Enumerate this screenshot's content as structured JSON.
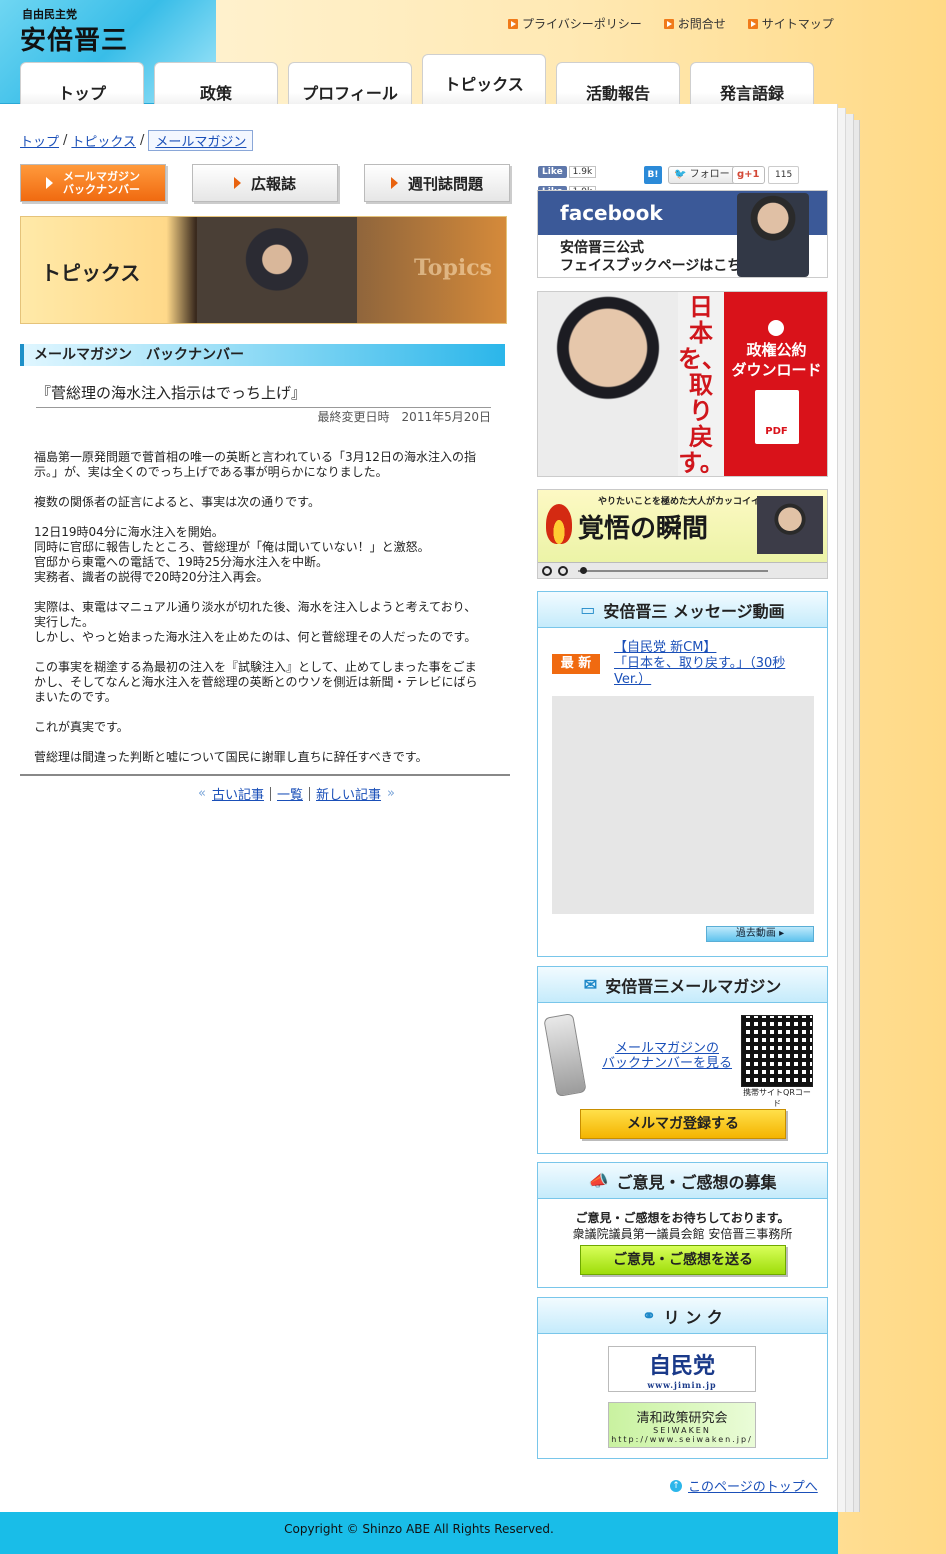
{
  "header": {
    "party": "自由民主党",
    "name": "安倍晋三",
    "util_links": [
      "プライバシーポリシー",
      "お問合せ",
      "サイトマップ"
    ]
  },
  "nav": {
    "tabs": [
      "トップ",
      "政策",
      "プロフィール",
      "トピックス",
      "活動報告",
      "発言語録"
    ],
    "active": "トピックス"
  },
  "breadcrumb": {
    "items": [
      "トップ",
      "トピックス",
      "メールマガジン"
    ]
  },
  "subnav": {
    "buttons": [
      "メールマガジン\nバックナンバー",
      "広報誌",
      "週刊誌問題"
    ]
  },
  "hero": {
    "label": "トピックス",
    "en_label": "Topics"
  },
  "section": {
    "title": "メールマガジン　バックナンバー"
  },
  "article": {
    "title": "『菅総理の海水注入指示はでっち上げ』",
    "date": "最終変更日時　2011年5月20日",
    "paragraphs": [
      "福島第一原発問題で菅首相の唯一の英断と言われている「3月12日の海水注入の指示。」が、実は全くのでっち上げである事が明らかになりました。",
      "複数の関係者の証言によると、事実は次の通りです。",
      "12日19時04分に海水注入を開始。\n同時に官邸に報告したところ、菅総理が「俺は聞いていない！」と激怒。\n官邸から東電への電話で、19時25分海水注入を中断。\n実務者、識者の説得で20時20分注入再会。",
      "実際は、東電はマニュアル通り淡水が切れた後、海水を注入しようと考えており、実行した。\nしかし、やっと始まった海水注入を止めたのは、何と菅総理その人だったのです。",
      "この事実を糊塗する為最初の注入を『試験注入』として、止めてしまった事をごまかし、そしてなんと海水注入を菅総理の英断とのウソを側近は新聞・テレビにばらまいたのです。",
      "これが真実です。",
      "菅総理は間違った判断と嘘について国民に謝罪し直ちに辞任すべきです。"
    ]
  },
  "pager": {
    "prev": "古い記事",
    "list": "一覧",
    "next": "新しい記事"
  },
  "social": {
    "like": "Like",
    "like_count_1": "1.9k",
    "like_count_2": "1.9k",
    "hatena": "B!",
    "twitter": "フォロー",
    "gplus": "+1",
    "gplus_count": "115"
  },
  "fb_banner": {
    "logo": "facebook",
    "text": "安倍晋三公式\nフェイスブックページはこちら"
  },
  "manifesto_banner": {
    "slogan": "日本を、取り戻す。",
    "download": "政権公約\nダウンロード",
    "pdf": "PDF"
  },
  "kakugo_banner": {
    "sub": "やりたいことを極めた大人がカッコイイ！",
    "title": "覚悟の瞬間"
  },
  "video_box": {
    "title": "安倍晋三 メッセージ動画",
    "badge": "最 新",
    "latest_link": "【自民党 新CM】\n「日本を、取り戻す。」（30秒Ver.）",
    "past_button": "過去動画"
  },
  "mail_box": {
    "title": "安倍晋三メールマガジン",
    "backnumber_link": "メールマガジンの\nバックナンバーを見る",
    "qr_caption": "携帯サイトQRコード",
    "register_button": "メルマガ登録する"
  },
  "opinion_box": {
    "title": "ご意見・ご感想の募集",
    "line1": "ご意見・ご感想をお待ちしております。",
    "line2": "衆議院議員第一議員会館 安倍晋三事務所",
    "send_button": "ご意見・ご感想を送る"
  },
  "link_box": {
    "title": "リ ン ク",
    "jimin": "自民党",
    "jimin_url": "www.jimin.jp",
    "seiwa": "清和政策研究会",
    "seiwa_en": "SEIWAKEN",
    "seiwa_url": "http://www.seiwaken.jp/"
  },
  "pagetop": "このページのトップへ",
  "footer": "Copyright © Shinzo ABE All Rights Reserved."
}
